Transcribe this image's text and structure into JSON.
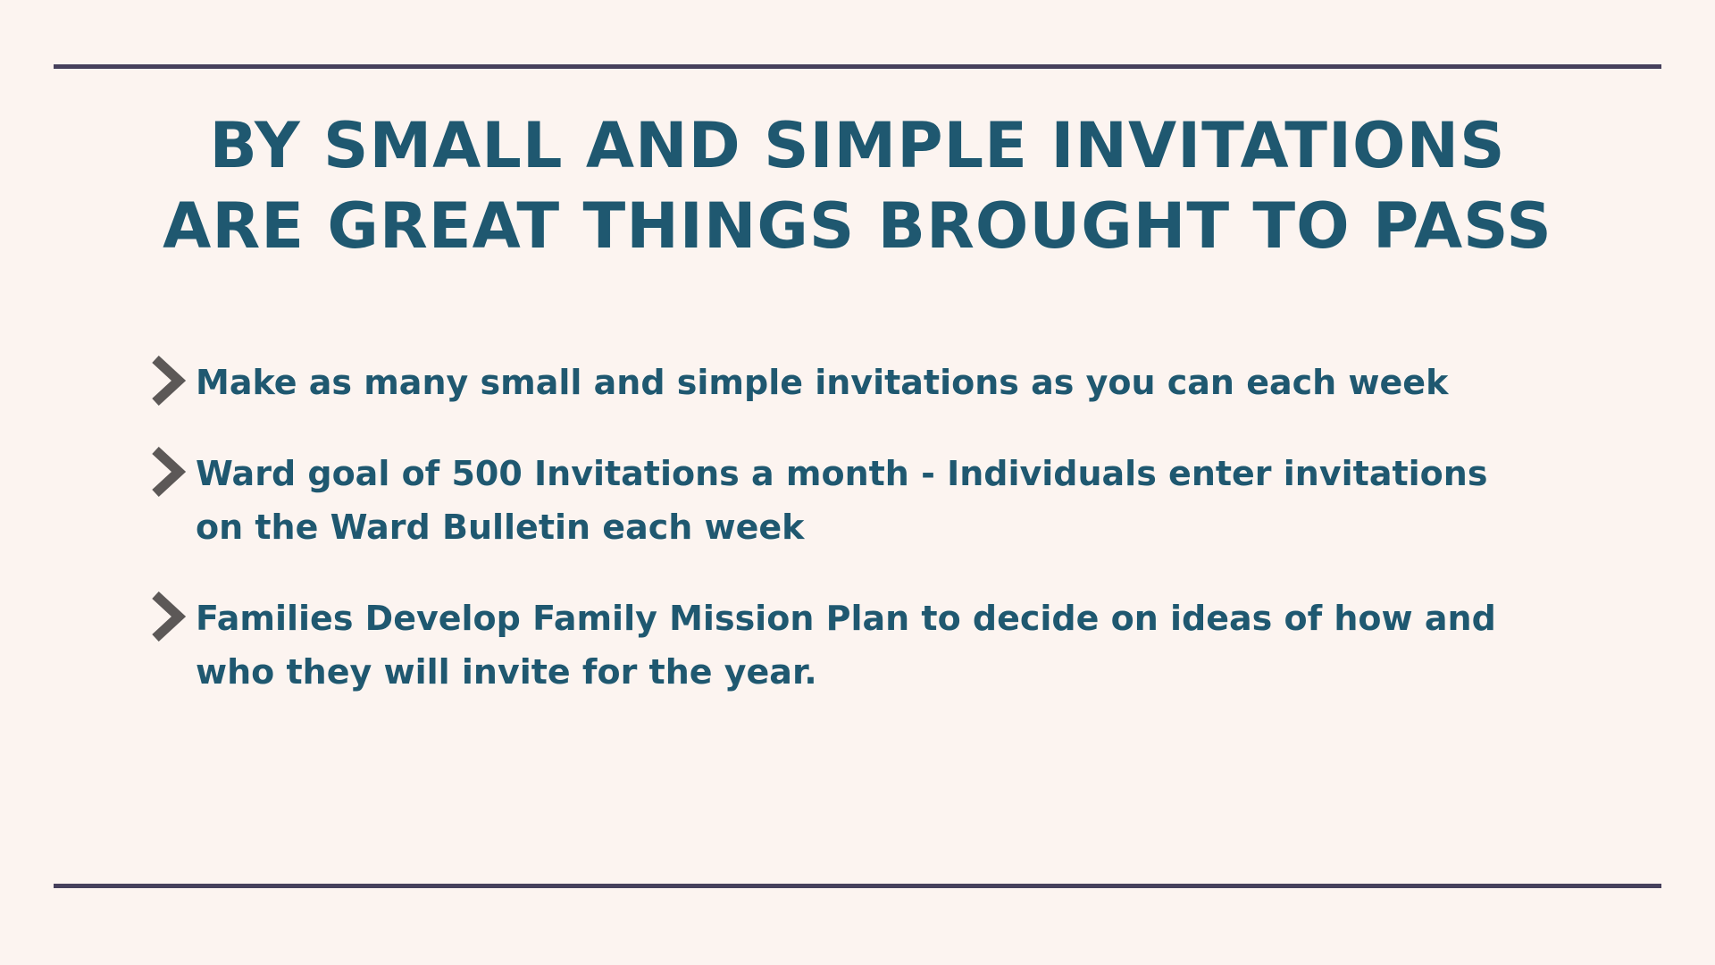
{
  "slide": {
    "title_lines": [
      "BY SMALL AND SIMPLE INVITATIONS",
      "ARE GREAT THINGS BROUGHT TO PASS"
    ],
    "bullets": [
      {
        "icon": "chevron-right-icon",
        "text": "Make as many small and simple invitations as you can each week"
      },
      {
        "icon": "chevron-right-icon",
        "text": "Ward goal of 500 Invitations a month - Individuals enter invitations on the Ward Bulletin each week"
      },
      {
        "icon": "chevron-right-icon",
        "text": "Families Develop Family Mission Plan to decide on ideas of how and who they will invite for the year."
      }
    ]
  },
  "colors": {
    "background": "#fcf4f0",
    "rule": "#46405c",
    "text": "#1f5870",
    "chevron": "#5c5857"
  }
}
